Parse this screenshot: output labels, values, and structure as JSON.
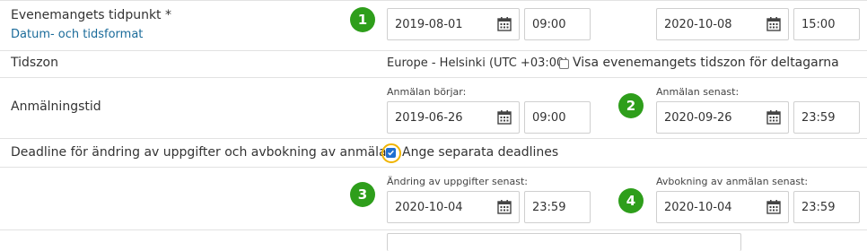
{
  "event_time": {
    "label": "Evenemangets tidpunkt *",
    "format_link": "Datum- och tidsformat",
    "badge": "1",
    "start_date": "2019-08-01",
    "start_time": "09:00",
    "end_date": "2020-10-08",
    "end_time": "15:00"
  },
  "timezone": {
    "label": "Tidszon",
    "value": "Europe - Helsinki (UTC +03:00)",
    "show_checkbox_label": "Visa evenemangets tidszon för deltagarna",
    "show_checked": false
  },
  "registration": {
    "label": "Anmälningstid",
    "start_caption": "Anmälan börjar:",
    "start_date": "2019-06-26",
    "start_time": "09:00",
    "badge": "2",
    "end_caption": "Anmälan senast:",
    "end_date": "2020-09-26",
    "end_time": "23:59"
  },
  "deadline": {
    "label": "Deadline för ändring av uppgifter och avbokning av anmälan",
    "separate_label": "Ange separata deadlines",
    "separate_checked": true,
    "badge_change": "3",
    "change_caption": "Ändring av uppgifter senast:",
    "change_date": "2020-10-04",
    "change_time": "23:59",
    "badge_cancel": "4",
    "cancel_caption": "Avbokning av anmälan senast:",
    "cancel_date": "2020-10-04",
    "cancel_time": "23:59"
  },
  "colors": {
    "badge": "#2e9e1b",
    "link": "#1a6b9a",
    "highlight_ring": "#f0b400",
    "checkbox_checked": "#1f6fd1"
  }
}
